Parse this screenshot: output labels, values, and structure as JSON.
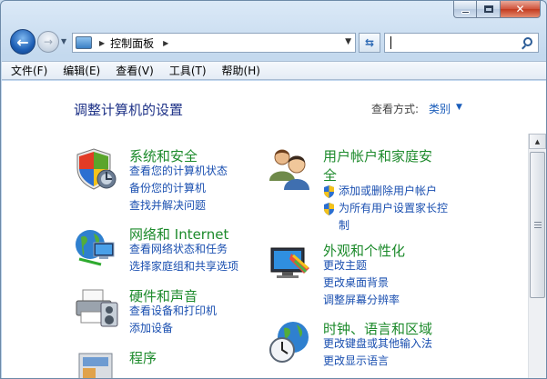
{
  "window": {
    "caption": {
      "minimize": "",
      "maximize": "",
      "close": "✕"
    }
  },
  "nav": {
    "back": "←",
    "forward": "→",
    "address": "控制面板",
    "search_placeholder": ""
  },
  "menu": [
    "文件(F)",
    "编辑(E)",
    "查看(V)",
    "工具(T)",
    "帮助(H)"
  ],
  "content": {
    "title": "调整计算机的设置",
    "view_label": "查看方式:",
    "view_value": "类别"
  },
  "categories": [
    {
      "title": "系统和安全",
      "icon": "shield-icon",
      "links": [
        "查看您的计算机状态",
        "备份您的计算机",
        "查找并解决问题"
      ]
    },
    {
      "title": "网络和 Internet",
      "icon": "globe-network-icon",
      "links": [
        "查看网络状态和任务",
        "选择家庭组和共享选项"
      ]
    },
    {
      "title": "硬件和声音",
      "icon": "printer-icon",
      "links": [
        "查看设备和打印机",
        "添加设备"
      ]
    },
    {
      "title": "程序",
      "icon": "programs-icon",
      "links": []
    },
    {
      "title_line1": "用户帐户和家庭安",
      "title_line2": "全",
      "icon": "users-icon",
      "links": [
        "添加或删除用户帐户",
        "为所有用户设置家长控",
        "制"
      ]
    },
    {
      "title": "外观和个性化",
      "icon": "monitor-paint-icon",
      "links": [
        "更改主题",
        "更改桌面背景",
        "调整屏幕分辨率"
      ]
    },
    {
      "title": "时钟、语言和区域",
      "icon": "clock-globe-icon",
      "links": [
        "更改键盘或其他输入法",
        "更改显示语言"
      ]
    }
  ],
  "colors": {
    "category_title": "#1c8a2b",
    "link": "#1a4fb0",
    "page_title": "#1e3287"
  }
}
